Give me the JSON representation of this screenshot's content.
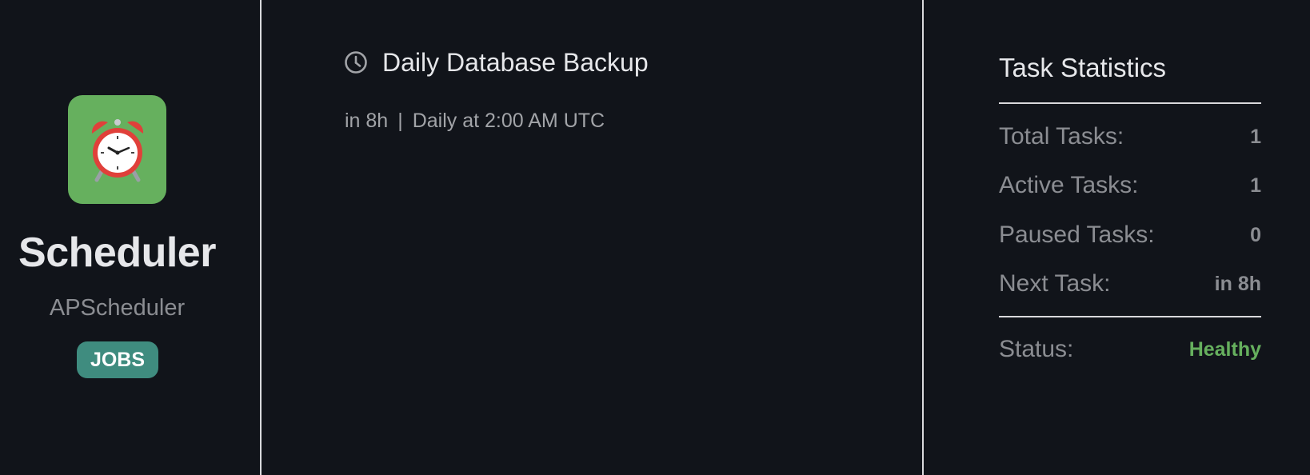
{
  "app": {
    "name": "Scheduler",
    "subtitle": "APScheduler",
    "badge": "JOBS",
    "icon": "alarm-clock-icon"
  },
  "task": {
    "title": "Daily Database Backup",
    "next_run": "in 8h",
    "separator": "|",
    "schedule": "Daily at 2:00 AM UTC",
    "icon": "clock-icon"
  },
  "stats": {
    "title": "Task Statistics",
    "rows": [
      {
        "label": "Total Tasks:",
        "value": "1"
      },
      {
        "label": "Active Tasks:",
        "value": "1"
      },
      {
        "label": "Paused Tasks:",
        "value": "0"
      },
      {
        "label": "Next Task:",
        "value": "in 8h"
      }
    ],
    "status": {
      "label": "Status:",
      "value": "Healthy"
    }
  },
  "colors": {
    "background": "#11141a",
    "icon_bg": "#66b05e",
    "badge_bg": "#3f8c7f",
    "healthy": "#66b05e"
  }
}
